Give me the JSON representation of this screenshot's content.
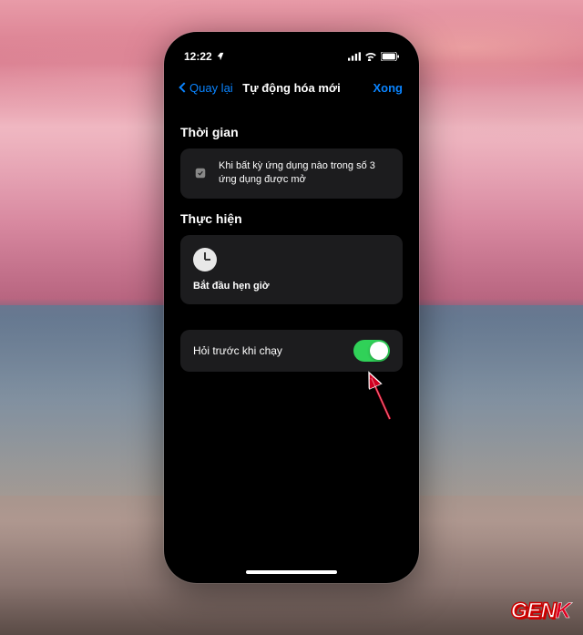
{
  "status_bar": {
    "time": "12:22",
    "location_icon": "location"
  },
  "nav": {
    "back_label": "Quay lại",
    "title": "Tự động hóa mới",
    "done_label": "Xong"
  },
  "sections": {
    "when": {
      "header": "Thời gian",
      "condition_text": "Khi bất kỳ ứng dụng nào trong số 3 ứng dụng được mở"
    },
    "do": {
      "header": "Thực hiện",
      "action_label": "Bắt đầu hẹn giờ"
    }
  },
  "toggle": {
    "label": "Hỏi trước khi chạy",
    "state": "on"
  },
  "branding": {
    "logo_text": "GEN",
    "logo_accent": "K"
  }
}
